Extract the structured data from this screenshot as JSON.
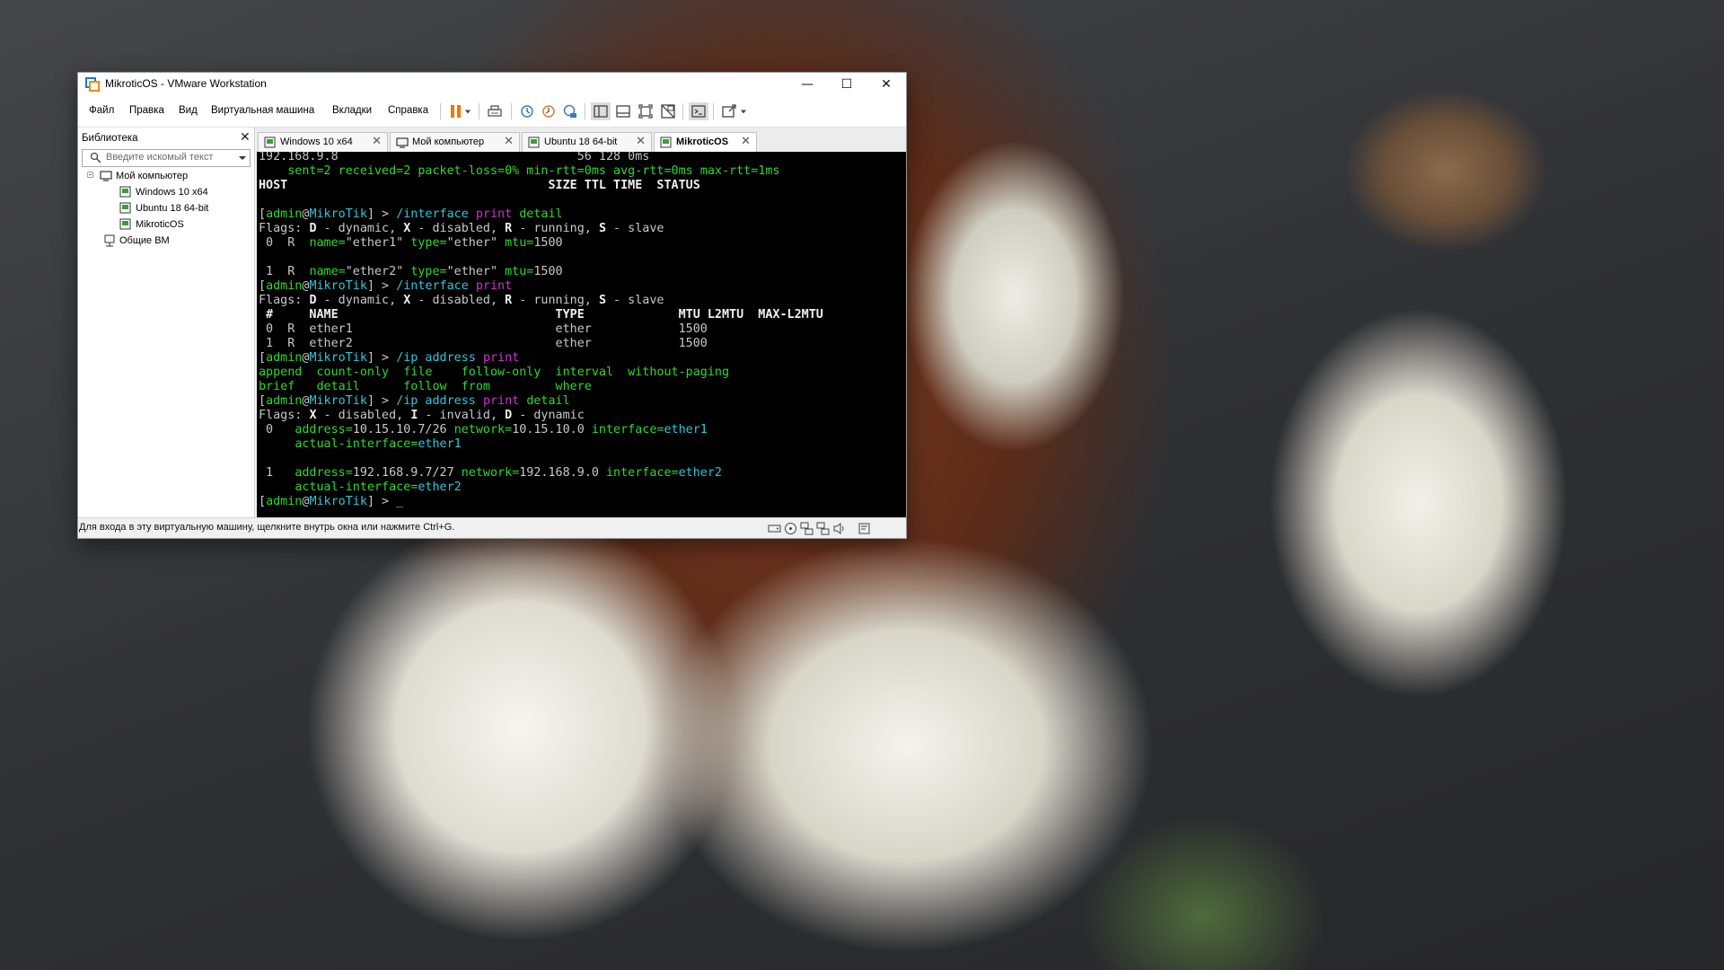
{
  "window": {
    "title": "MikroticOS - VMware Workstation",
    "controls": {
      "minimize": "—",
      "maximize": "☐",
      "close": "✕"
    }
  },
  "menu": {
    "items": [
      "Файл",
      "Правка",
      "Вид",
      "Виртуальная машина",
      "Вкладки",
      "Справка"
    ]
  },
  "library": {
    "title": "Библиотека",
    "close": "✕",
    "search_placeholder": "Введите искомый текст",
    "tree": {
      "root": "Мой компьютер",
      "vms": [
        "Windows 10 x64",
        "Ubuntu 18 64-bit",
        "MikroticOS"
      ],
      "shared": "Общие ВМ"
    }
  },
  "tabs": [
    {
      "label": "Windows 10 x64",
      "close": "✕"
    },
    {
      "label": "Мой компьютер",
      "close": "✕"
    },
    {
      "label": "Ubuntu 18 64-bit",
      "close": "✕"
    },
    {
      "label": "MikroticOS",
      "close": "✕",
      "active": true
    }
  ],
  "console": {
    "lines": [
      [
        {
          "t": "192.168.9.8                                 56 128 0ms",
          "c": "w"
        }
      ],
      [
        {
          "t": "    sent=2 received=2 packet-loss=0% min-rtt=0ms avg-rtt=0ms max-rtt=1ms",
          "c": "g"
        }
      ],
      [
        {
          "t": "HOST                                    SIZE TTL TIME  STATUS",
          "c": "wb"
        }
      ],
      [
        {
          "t": "",
          "c": "w"
        }
      ],
      [
        {
          "t": "[",
          "c": "w"
        },
        {
          "t": "admin",
          "c": "g"
        },
        {
          "t": "@",
          "c": "w"
        },
        {
          "t": "MikroTik",
          "c": "c"
        },
        {
          "t": "] > ",
          "c": "w"
        },
        {
          "t": "/interface ",
          "c": "c"
        },
        {
          "t": "print ",
          "c": "m"
        },
        {
          "t": "detail",
          "c": "g"
        }
      ],
      [
        {
          "t": "Flags: ",
          "c": "w"
        },
        {
          "t": "D",
          "c": "wb"
        },
        {
          "t": " - dynamic, ",
          "c": "w"
        },
        {
          "t": "X",
          "c": "wb"
        },
        {
          "t": " - disabled, ",
          "c": "w"
        },
        {
          "t": "R",
          "c": "wb"
        },
        {
          "t": " - running, ",
          "c": "w"
        },
        {
          "t": "S",
          "c": "wb"
        },
        {
          "t": " - slave",
          "c": "w"
        }
      ],
      [
        {
          "t": " 0  R  ",
          "c": "w"
        },
        {
          "t": "name=",
          "c": "g"
        },
        {
          "t": "\"ether1\" ",
          "c": "w"
        },
        {
          "t": "type=",
          "c": "g"
        },
        {
          "t": "\"ether\" ",
          "c": "w"
        },
        {
          "t": "mtu=",
          "c": "g"
        },
        {
          "t": "1500",
          "c": "w"
        }
      ],
      [
        {
          "t": "",
          "c": "w"
        }
      ],
      [
        {
          "t": " 1  R  ",
          "c": "w"
        },
        {
          "t": "name=",
          "c": "g"
        },
        {
          "t": "\"ether2\" ",
          "c": "w"
        },
        {
          "t": "type=",
          "c": "g"
        },
        {
          "t": "\"ether\" ",
          "c": "w"
        },
        {
          "t": "mtu=",
          "c": "g"
        },
        {
          "t": "1500",
          "c": "w"
        }
      ],
      [
        {
          "t": "[",
          "c": "w"
        },
        {
          "t": "admin",
          "c": "g"
        },
        {
          "t": "@",
          "c": "w"
        },
        {
          "t": "MikroTik",
          "c": "c"
        },
        {
          "t": "] > ",
          "c": "w"
        },
        {
          "t": "/interface ",
          "c": "c"
        },
        {
          "t": "print",
          "c": "m"
        }
      ],
      [
        {
          "t": "Flags: ",
          "c": "w"
        },
        {
          "t": "D",
          "c": "wb"
        },
        {
          "t": " - dynamic, ",
          "c": "w"
        },
        {
          "t": "X",
          "c": "wb"
        },
        {
          "t": " - disabled, ",
          "c": "w"
        },
        {
          "t": "R",
          "c": "wb"
        },
        {
          "t": " - running, ",
          "c": "w"
        },
        {
          "t": "S",
          "c": "wb"
        },
        {
          "t": " - slave",
          "c": "w"
        }
      ],
      [
        {
          "t": " #     NAME                              TYPE             MTU L2MTU  MAX-L2MTU",
          "c": "wb"
        }
      ],
      [
        {
          "t": " 0  R  ether1                            ether            1500",
          "c": "w"
        }
      ],
      [
        {
          "t": " 1  R  ether2                            ether            1500",
          "c": "w"
        }
      ],
      [
        {
          "t": "[",
          "c": "w"
        },
        {
          "t": "admin",
          "c": "g"
        },
        {
          "t": "@",
          "c": "w"
        },
        {
          "t": "MikroTik",
          "c": "c"
        },
        {
          "t": "] > ",
          "c": "w"
        },
        {
          "t": "/ip address ",
          "c": "c"
        },
        {
          "t": "print",
          "c": "m"
        }
      ],
      [
        {
          "t": "append  count-only  file    follow-only  interval  without-paging",
          "c": "g"
        }
      ],
      [
        {
          "t": "brief   detail      follow  from         where",
          "c": "g"
        }
      ],
      [
        {
          "t": "[",
          "c": "w"
        },
        {
          "t": "admin",
          "c": "g"
        },
        {
          "t": "@",
          "c": "w"
        },
        {
          "t": "MikroTik",
          "c": "c"
        },
        {
          "t": "] > ",
          "c": "w"
        },
        {
          "t": "/ip address ",
          "c": "c"
        },
        {
          "t": "print ",
          "c": "m"
        },
        {
          "t": "detail",
          "c": "g"
        }
      ],
      [
        {
          "t": "Flags: ",
          "c": "w"
        },
        {
          "t": "X",
          "c": "wb"
        },
        {
          "t": " - disabled, ",
          "c": "w"
        },
        {
          "t": "I",
          "c": "wb"
        },
        {
          "t": " - invalid, ",
          "c": "w"
        },
        {
          "t": "D",
          "c": "wb"
        },
        {
          "t": " - dynamic",
          "c": "w"
        }
      ],
      [
        {
          "t": " 0   ",
          "c": "w"
        },
        {
          "t": "address=",
          "c": "g"
        },
        {
          "t": "10.15.10.7/26 ",
          "c": "w"
        },
        {
          "t": "network=",
          "c": "g"
        },
        {
          "t": "10.15.10.0 ",
          "c": "w"
        },
        {
          "t": "interface=",
          "c": "g"
        },
        {
          "t": "ether1",
          "c": "c"
        }
      ],
      [
        {
          "t": "     ",
          "c": "w"
        },
        {
          "t": "actual-interface=",
          "c": "g"
        },
        {
          "t": "ether1",
          "c": "c"
        }
      ],
      [
        {
          "t": "",
          "c": "w"
        }
      ],
      [
        {
          "t": " 1   ",
          "c": "w"
        },
        {
          "t": "address=",
          "c": "g"
        },
        {
          "t": "192.168.9.7/27 ",
          "c": "w"
        },
        {
          "t": "network=",
          "c": "g"
        },
        {
          "t": "192.168.9.0 ",
          "c": "w"
        },
        {
          "t": "interface=",
          "c": "g"
        },
        {
          "t": "ether2",
          "c": "c"
        }
      ],
      [
        {
          "t": "     ",
          "c": "w"
        },
        {
          "t": "actual-interface=",
          "c": "g"
        },
        {
          "t": "ether2",
          "c": "c"
        }
      ],
      [
        {
          "t": "[",
          "c": "w"
        },
        {
          "t": "admin",
          "c": "g"
        },
        {
          "t": "@",
          "c": "w"
        },
        {
          "t": "MikroTik",
          "c": "c"
        },
        {
          "t": "] > _",
          "c": "w"
        }
      ]
    ]
  },
  "status": {
    "text": "Для входа в эту виртуальную машину, щелкните внутрь окна или нажмите Ctrl+G."
  },
  "colors": {
    "terminal_bg": "#000000",
    "terminal_white": "#c8c8c8",
    "terminal_green": "#2fd82f",
    "terminal_cyan": "#2fc6d8",
    "terminal_magenta": "#d030d0",
    "pause_orange": "#f07800"
  },
  "icons": {
    "toolbar": [
      "pause-icon",
      "dropdown-arrow-icon",
      "send-ctrl-alt-del-icon",
      "snapshot-icon",
      "revert-snapshot-icon",
      "snapshot-manager-icon",
      "show-library-icon",
      "thumbnail-bar-icon",
      "fullscreen-icon",
      "unity-icon",
      "console-view-icon",
      "stretch-guest-icon",
      "dropdown-arrow-icon"
    ],
    "status": [
      "hard-disk-icon",
      "cd-dvd-icon",
      "network-adapter-icon",
      "network-adapter-2-icon",
      "sound-card-icon",
      "message-log-icon"
    ]
  }
}
